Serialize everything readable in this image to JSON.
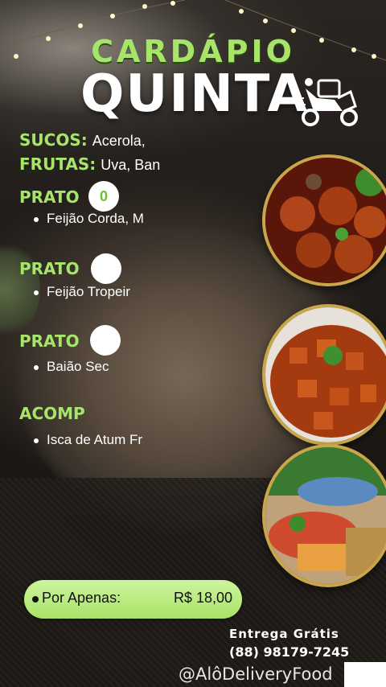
{
  "header": {
    "cardapio": "CARDÁPIO",
    "day": "QUINTA"
  },
  "icons": {
    "delivery": "delivery-scooter-icon"
  },
  "info": {
    "sucos_label": "SUCOS:",
    "sucos_value": "Acerola,",
    "frutas_label": "FRUTAS:",
    "frutas_value": "Uva, Ban"
  },
  "pratos": [
    {
      "title": "PRATO",
      "number": "0",
      "item": "Feijão Corda, M"
    },
    {
      "title": "PRATO",
      "number": "",
      "item": "Feijão Tropeir"
    },
    {
      "title": "PRATO",
      "number": "",
      "item": "Baião Sec"
    }
  ],
  "acomp": {
    "title": "ACOMP",
    "item": "Isca de Atum Fr"
  },
  "price": {
    "label": "Por Apenas:",
    "value": "R$ 18,00"
  },
  "footer": {
    "delivery": "Entrega  Grátis",
    "phone": "(88) 98179-7245",
    "handle": "@AlôDeliveryFood"
  },
  "colors": {
    "accent": "#a6e46a",
    "pill": "#b9ea7e",
    "frame": "#c9a64a"
  }
}
